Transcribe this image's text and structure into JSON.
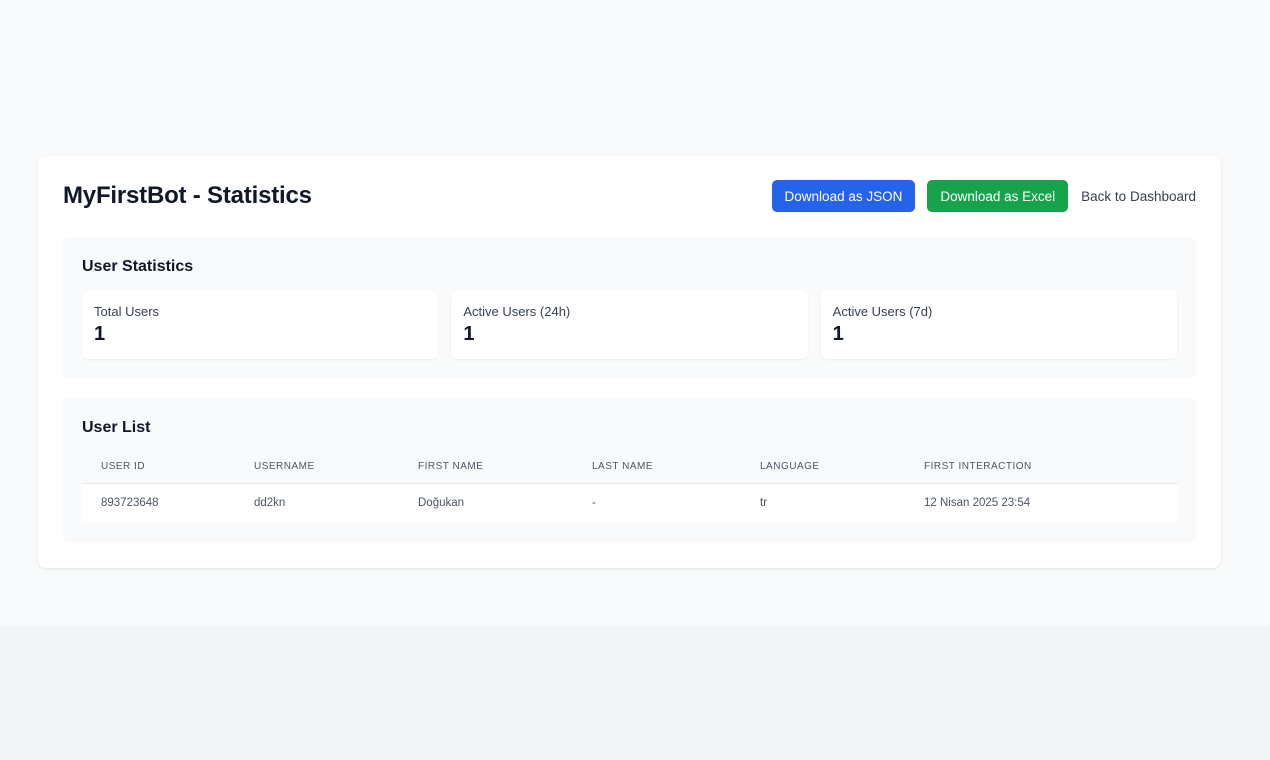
{
  "page": {
    "title": "MyFirstBot - Statistics",
    "buttons": {
      "download_json": "Download as JSON",
      "download_excel": "Download as Excel",
      "back": "Back to Dashboard"
    }
  },
  "user_statistics": {
    "title": "User Statistics",
    "cards": [
      {
        "label": "Total Users",
        "value": "1"
      },
      {
        "label": "Active Users (24h)",
        "value": "1"
      },
      {
        "label": "Active Users (7d)",
        "value": "1"
      }
    ]
  },
  "user_list": {
    "title": "User List",
    "columns": [
      "USER ID",
      "USERNAME",
      "FIRST NAME",
      "LAST NAME",
      "LANGUAGE",
      "FIRST INTERACTION"
    ],
    "rows": [
      [
        "893723648",
        "dd2kn",
        "Doğukan",
        "-",
        "tr",
        "12 Nisan 2025 23:54"
      ]
    ]
  },
  "colors": {
    "primary_blue": "#2563eb",
    "success_green": "#16a34a",
    "background": "#f9fafb"
  }
}
